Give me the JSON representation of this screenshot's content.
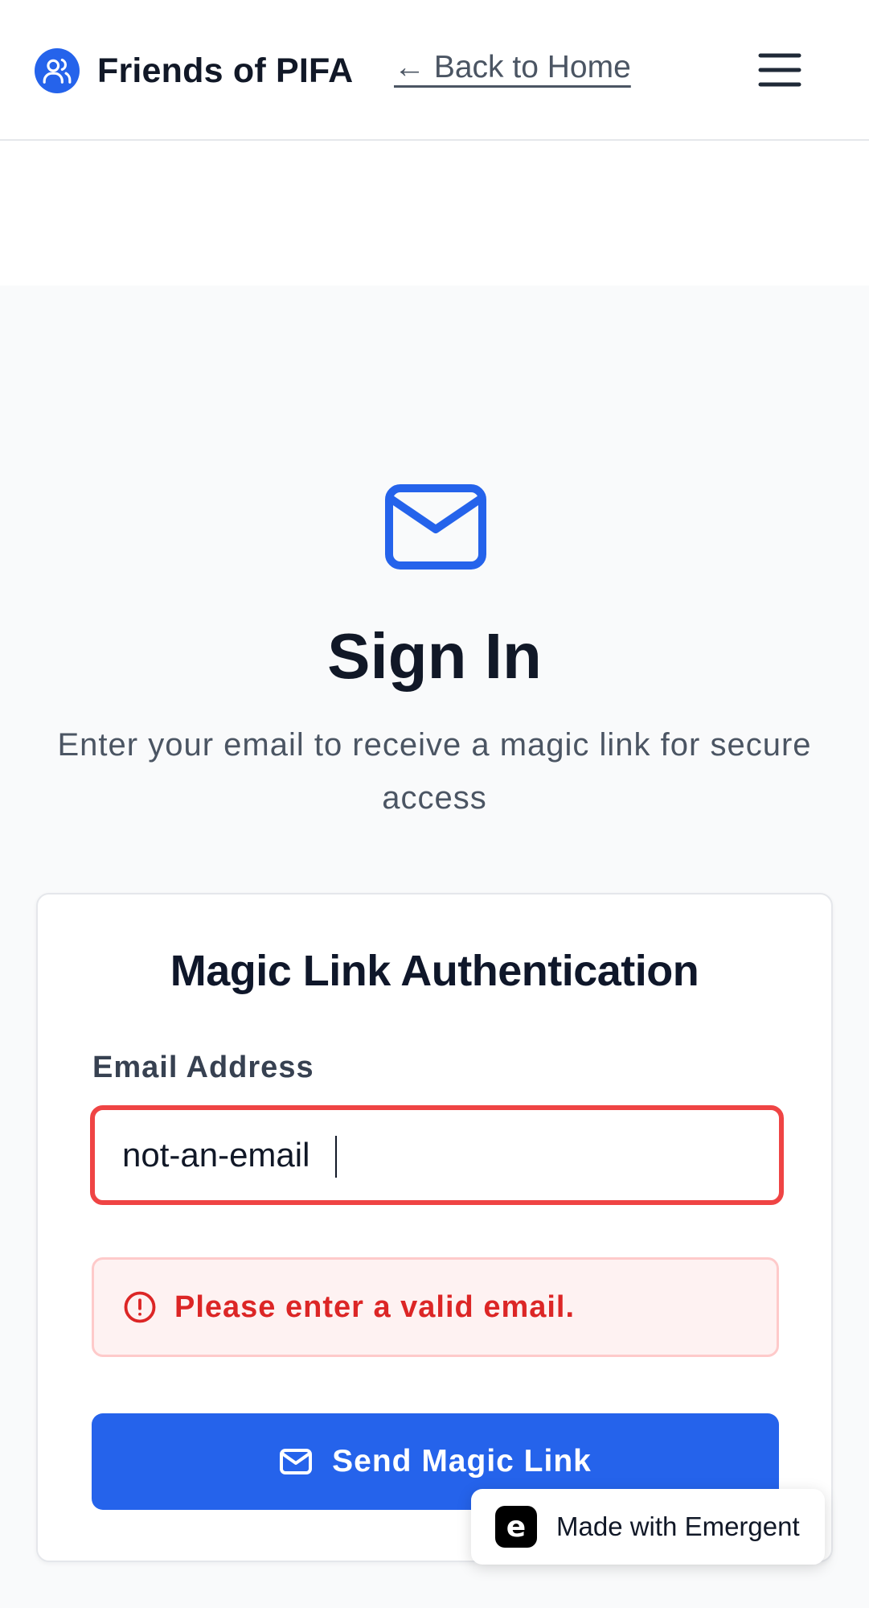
{
  "header": {
    "brand_name": "Friends of PIFA",
    "back_link": "← Back to Home"
  },
  "hero": {
    "title": "Sign In",
    "subtitle": "Enter your email to receive a magic link for secure access"
  },
  "card": {
    "title": "Magic Link Authentication",
    "email_label": "Email Address",
    "email_value": "not-an-email",
    "error_message": "Please enter a valid email.",
    "submit_label": "Send Magic Link"
  },
  "badge": {
    "logo_letter": "e",
    "text": "Made with Emergent"
  },
  "colors": {
    "accent": "#2563eb",
    "error": "#dc2626",
    "error_border": "#ef4444",
    "error_bg": "#fef2f2"
  },
  "icons": {
    "brand": "users-icon",
    "menu": "hamburger-menu-icon",
    "hero": "mail-icon",
    "error": "alert-circle-icon",
    "button": "mail-icon"
  }
}
